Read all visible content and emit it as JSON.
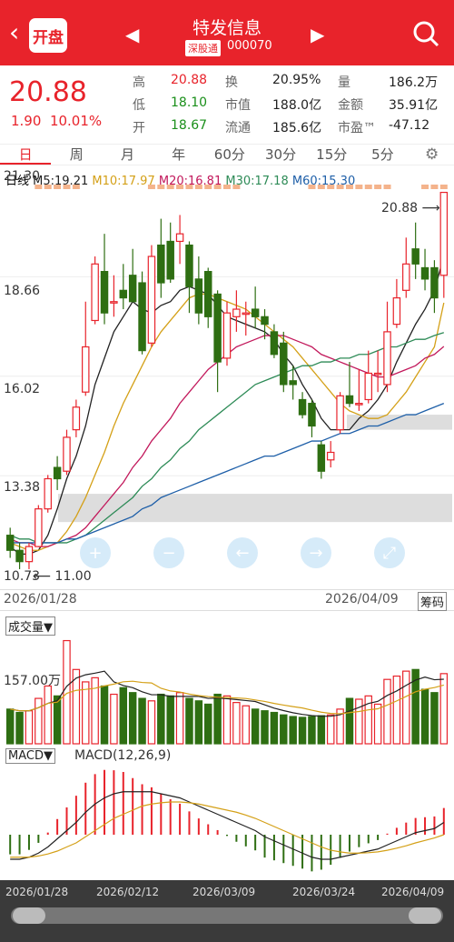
{
  "header": {
    "back_icon": "‹",
    "kaipan": "开盘",
    "prev_icon": "◀",
    "next_icon": "▶",
    "stock_name": "特发信息",
    "market_badge": "深股通",
    "stock_code": "000070"
  },
  "quote": {
    "price": "20.88",
    "change": "1.90",
    "change_pct": "10.01%",
    "fields": [
      {
        "label": "高",
        "value": "20.88",
        "color": "#e8232b"
      },
      {
        "label": "换",
        "value": "20.95%",
        "color": "#222"
      },
      {
        "label": "量",
        "value": "186.2万",
        "color": "#222"
      },
      {
        "label": "低",
        "value": "18.10",
        "color": "#1a8f1a"
      },
      {
        "label": "市值",
        "value": "188.0亿",
        "color": "#222"
      },
      {
        "label": "金额",
        "value": "35.91亿",
        "color": "#222"
      },
      {
        "label": "开",
        "value": "18.67",
        "color": "#1a8f1a"
      },
      {
        "label": "流通",
        "value": "185.6亿",
        "color": "#222"
      },
      {
        "label": "市盈™",
        "value": "-47.12",
        "color": "#222"
      }
    ]
  },
  "period_tabs": [
    "日",
    "周",
    "月",
    "年",
    "60分",
    "30分",
    "15分",
    "5分"
  ],
  "active_tab": "日",
  "ma_line": {
    "label": "日线",
    "items": [
      {
        "text": "M5:19.21",
        "color": "#222"
      },
      {
        "text": "M10:17.97",
        "color": "#d4a017"
      },
      {
        "text": "M20:16.81",
        "color": "#c2185b"
      },
      {
        "text": "M30:17.18",
        "color": "#2e8b57"
      },
      {
        "text": "M60:15.30",
        "color": "#1e5fa8"
      }
    ]
  },
  "price_axis": [
    "21.30",
    "18.66",
    "16.02",
    "13.38",
    "10.73"
  ],
  "high_marker": "20.88",
  "low_marker": "11.00",
  "date_start": "2026/01/28",
  "date_end": "2026/04/09",
  "chips_button": "筹码",
  "volume_selector": "成交量",
  "volume_axis_label": "157.00万",
  "macd_selector": "MACD",
  "macd_params": "MACD(12,26,9)",
  "bottom_dates": [
    "2026/01/28",
    "2026/02/12",
    "2026/03/09",
    "2026/03/24",
    "2026/04/09"
  ],
  "colors": {
    "up": "#e8232b",
    "down": "#2e6e12",
    "accent": "#e8232b"
  },
  "chart_data": {
    "type": "candlestick",
    "ylim": [
      10.73,
      21.3
    ],
    "candles": [
      [
        11.8,
        11.4,
        12.0,
        11.2
      ],
      [
        11.4,
        11.1,
        11.6,
        10.9
      ],
      [
        11.1,
        11.5,
        11.6,
        10.9
      ],
      [
        11.5,
        12.5,
        12.6,
        11.5
      ],
      [
        12.5,
        13.3,
        13.4,
        12.4
      ],
      [
        13.6,
        13.3,
        13.9,
        13.0
      ],
      [
        13.5,
        14.4,
        14.6,
        13.4
      ],
      [
        14.6,
        15.2,
        15.4,
        14.4
      ],
      [
        15.6,
        16.8,
        18.0,
        15.5
      ],
      [
        17.5,
        19.0,
        19.2,
        17.4
      ],
      [
        18.8,
        17.7,
        19.8,
        17.4
      ],
      [
        18.0,
        18.0,
        18.7,
        17.6
      ],
      [
        18.3,
        18.1,
        19.0,
        17.8
      ],
      [
        18.7,
        18.0,
        19.4,
        18.0
      ],
      [
        18.5,
        16.7,
        18.8,
        16.6
      ],
      [
        16.9,
        19.2,
        19.5,
        16.8
      ],
      [
        19.5,
        18.5,
        20.2,
        18.1
      ],
      [
        19.6,
        18.6,
        20.1,
        18.5
      ],
      [
        19.6,
        19.8,
        20.3,
        19.0
      ],
      [
        19.5,
        18.4,
        19.6,
        17.7
      ],
      [
        18.6,
        17.7,
        19.2,
        17.4
      ],
      [
        18.8,
        17.6,
        18.9,
        17.3
      ],
      [
        18.2,
        16.4,
        18.3,
        15.6
      ],
      [
        16.5,
        17.7,
        18.0,
        16.3
      ],
      [
        17.6,
        17.8,
        18.3,
        17.2
      ],
      [
        17.7,
        17.7,
        18.0,
        17.1
      ],
      [
        17.8,
        17.6,
        18.4,
        17.3
      ],
      [
        17.6,
        17.4,
        17.8,
        17.0
      ],
      [
        17.2,
        16.6,
        17.4,
        16.5
      ],
      [
        16.9,
        15.8,
        17.2,
        15.6
      ],
      [
        15.9,
        15.8,
        16.3,
        15.4
      ],
      [
        15.4,
        15.0,
        15.6,
        14.9
      ],
      [
        15.3,
        14.7,
        15.4,
        14.4
      ],
      [
        14.2,
        13.5,
        14.3,
        13.3
      ],
      [
        13.8,
        14.0,
        14.3,
        13.6
      ],
      [
        14.6,
        15.5,
        15.6,
        14.5
      ],
      [
        15.5,
        15.3,
        16.4,
        15.2
      ],
      [
        15.3,
        15.3,
        16.2,
        15.1
      ],
      [
        15.4,
        16.1,
        16.7,
        15.3
      ],
      [
        16.1,
        16.1,
        16.7,
        15.6
      ],
      [
        15.8,
        17.2,
        18.0,
        15.6
      ],
      [
        17.4,
        18.1,
        18.6,
        17.3
      ],
      [
        18.3,
        19.0,
        19.7,
        18.1
      ],
      [
        19.4,
        19.0,
        20.1,
        18.6
      ],
      [
        18.9,
        18.6,
        19.4,
        18.3
      ],
      [
        18.9,
        18.1,
        19.1,
        17.7
      ],
      [
        18.7,
        20.9,
        20.9,
        18.1
      ]
    ],
    "ma5": [
      11.5,
      11.3,
      11.3,
      11.4,
      11.8,
      12.5,
      13.3,
      13.9,
      14.7,
      15.8,
      16.5,
      17.2,
      17.6,
      18.0,
      17.8,
      17.7,
      17.9,
      18.0,
      18.3,
      18.4,
      18.3,
      18.2,
      17.9,
      17.6,
      17.5,
      17.4,
      17.3,
      17.2,
      17.0,
      16.6,
      16.3,
      15.8,
      15.4,
      14.9,
      14.6,
      14.6,
      14.6,
      14.9,
      15.1,
      15.4,
      15.8,
      16.4,
      16.9,
      17.4,
      17.8,
      18.3,
      19.2
    ],
    "ma10": [
      11.6,
      11.5,
      11.4,
      11.4,
      11.5,
      11.6,
      11.9,
      12.3,
      12.8,
      13.4,
      14.0,
      14.7,
      15.3,
      15.8,
      16.3,
      16.8,
      17.2,
      17.5,
      17.8,
      18.1,
      18.2,
      18.2,
      18.1,
      18.0,
      17.9,
      17.8,
      17.6,
      17.4,
      17.2,
      17.0,
      16.8,
      16.5,
      16.2,
      15.9,
      15.6,
      15.3,
      15.1,
      15.0,
      14.9,
      14.9,
      15.0,
      15.3,
      15.6,
      16.0,
      16.4,
      16.8,
      17.97
    ],
    "ma20": [
      11.7,
      11.6,
      11.6,
      11.5,
      11.5,
      11.6,
      11.7,
      11.8,
      12.0,
      12.3,
      12.6,
      12.9,
      13.2,
      13.6,
      13.9,
      14.3,
      14.6,
      14.9,
      15.3,
      15.6,
      15.9,
      16.2,
      16.4,
      16.6,
      16.8,
      16.9,
      17.0,
      17.1,
      17.1,
      17.1,
      17.0,
      16.9,
      16.8,
      16.6,
      16.5,
      16.4,
      16.3,
      16.2,
      16.1,
      16.0,
      16.0,
      16.1,
      16.2,
      16.3,
      16.5,
      16.6,
      16.81
    ],
    "ma30": [
      11.8,
      11.7,
      11.7,
      11.6,
      11.6,
      11.6,
      11.6,
      11.7,
      11.8,
      12.0,
      12.2,
      12.4,
      12.6,
      12.8,
      13.1,
      13.3,
      13.6,
      13.8,
      14.1,
      14.3,
      14.6,
      14.8,
      15.0,
      15.2,
      15.4,
      15.6,
      15.8,
      15.9,
      16.0,
      16.1,
      16.2,
      16.3,
      16.3,
      16.4,
      16.4,
      16.5,
      16.5,
      16.6,
      16.6,
      16.7,
      16.8,
      16.8,
      16.9,
      17.0,
      17.0,
      17.1,
      17.18
    ],
    "ma60": [
      11.6,
      11.6,
      11.6,
      11.6,
      11.6,
      11.6,
      11.7,
      11.7,
      11.8,
      11.9,
      12.0,
      12.1,
      12.2,
      12.3,
      12.5,
      12.6,
      12.8,
      12.9,
      13.0,
      13.1,
      13.2,
      13.3,
      13.4,
      13.5,
      13.6,
      13.7,
      13.8,
      13.9,
      13.9,
      14.0,
      14.1,
      14.2,
      14.3,
      14.3,
      14.4,
      14.5,
      14.5,
      14.6,
      14.7,
      14.7,
      14.8,
      14.9,
      15.0,
      15.0,
      15.1,
      15.2,
      15.3
    ],
    "volume": [
      42,
      38,
      40,
      55,
      70,
      58,
      125,
      90,
      75,
      80,
      70,
      60,
      68,
      62,
      55,
      52,
      60,
      58,
      62,
      55,
      52,
      48,
      60,
      58,
      50,
      46,
      42,
      40,
      38,
      35,
      33,
      32,
      33,
      34,
      35,
      42,
      55,
      54,
      58,
      48,
      78,
      82,
      88,
      90,
      66,
      62,
      85
    ],
    "macd_dif": [
      -0.6,
      -0.6,
      -0.55,
      -0.45,
      -0.3,
      -0.1,
      0.1,
      0.3,
      0.55,
      0.75,
      0.9,
      1.0,
      1.05,
      1.05,
      1.05,
      1.05,
      1.0,
      0.95,
      0.9,
      0.8,
      0.7,
      0.6,
      0.5,
      0.4,
      0.3,
      0.2,
      0.1,
      -0.05,
      -0.15,
      -0.25,
      -0.35,
      -0.45,
      -0.55,
      -0.6,
      -0.6,
      -0.55,
      -0.5,
      -0.45,
      -0.4,
      -0.35,
      -0.25,
      -0.15,
      -0.05,
      0.05,
      0.1,
      0.15,
      0.3
    ],
    "macd_dea": [
      -0.55,
      -0.55,
      -0.55,
      -0.52,
      -0.47,
      -0.4,
      -0.3,
      -0.2,
      -0.05,
      0.1,
      0.25,
      0.4,
      0.5,
      0.6,
      0.7,
      0.75,
      0.78,
      0.8,
      0.8,
      0.78,
      0.75,
      0.7,
      0.65,
      0.6,
      0.55,
      0.48,
      0.4,
      0.3,
      0.2,
      0.1,
      0.0,
      -0.1,
      -0.2,
      -0.3,
      -0.38,
      -0.42,
      -0.45,
      -0.45,
      -0.44,
      -0.42,
      -0.38,
      -0.33,
      -0.27,
      -0.2,
      -0.14,
      -0.08,
      0.0
    ]
  }
}
